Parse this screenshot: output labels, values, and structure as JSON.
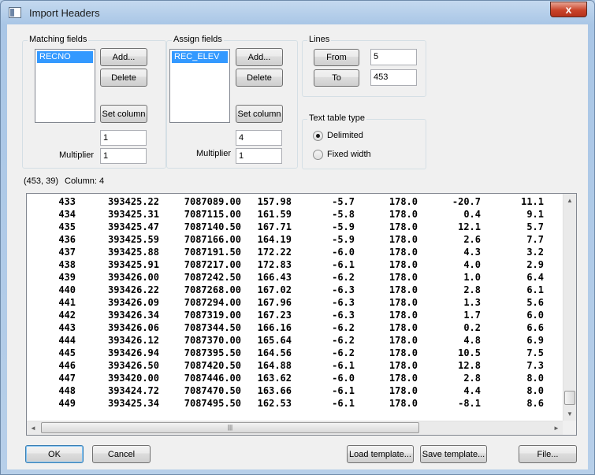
{
  "window": {
    "title": "Import Headers",
    "close_label": "x"
  },
  "matching": {
    "legend": "Matching fields",
    "selected_item": "RECNO",
    "add_label": "Add...",
    "delete_label": "Delete",
    "set_column_label": "Set column",
    "column_value": "1",
    "multiplier_label": "Multiplier",
    "multiplier_value": "1"
  },
  "assign": {
    "legend": "Assign fields",
    "selected_item": "REC_ELEV",
    "add_label": "Add...",
    "delete_label": "Delete",
    "set_column_label": "Set column",
    "column_value": "4",
    "multiplier_label": "Multiplier",
    "multiplier_value": "1"
  },
  "lines": {
    "legend": "Lines",
    "from_label": "From",
    "from_value": "5",
    "to_label": "To",
    "to_value": "453"
  },
  "text_table": {
    "legend": "Text table type",
    "delimited_label": "Delimited",
    "delimited_checked": true,
    "fixed_label": "Fixed width",
    "fixed_checked": false
  },
  "status": {
    "position": "(453, 39)",
    "column": "Column: 4"
  },
  "data_rows": [
    [
      "433",
      "393425.22",
      "7087089.00",
      "157.98",
      "-5.7",
      "178.0",
      "-20.7",
      "11.1"
    ],
    [
      "434",
      "393425.31",
      "7087115.00",
      "161.59",
      "-5.8",
      "178.0",
      "0.4",
      "9.1"
    ],
    [
      "435",
      "393425.47",
      "7087140.50",
      "167.71",
      "-5.9",
      "178.0",
      "12.1",
      "5.7"
    ],
    [
      "436",
      "393425.59",
      "7087166.00",
      "164.19",
      "-5.9",
      "178.0",
      "2.6",
      "7.7"
    ],
    [
      "437",
      "393425.88",
      "7087191.50",
      "172.22",
      "-6.0",
      "178.0",
      "4.3",
      "3.2"
    ],
    [
      "438",
      "393425.91",
      "7087217.00",
      "172.83",
      "-6.1",
      "178.0",
      "4.0",
      "2.9"
    ],
    [
      "439",
      "393426.00",
      "7087242.50",
      "166.43",
      "-6.2",
      "178.0",
      "1.0",
      "6.4"
    ],
    [
      "440",
      "393426.22",
      "7087268.00",
      "167.02",
      "-6.3",
      "178.0",
      "2.8",
      "6.1"
    ],
    [
      "441",
      "393426.09",
      "7087294.00",
      "167.96",
      "-6.3",
      "178.0",
      "1.3",
      "5.6"
    ],
    [
      "442",
      "393426.34",
      "7087319.00",
      "167.23",
      "-6.3",
      "178.0",
      "1.7",
      "6.0"
    ],
    [
      "443",
      "393426.06",
      "7087344.50",
      "166.16",
      "-6.2",
      "178.0",
      "0.2",
      "6.6"
    ],
    [
      "444",
      "393426.12",
      "7087370.00",
      "165.64",
      "-6.2",
      "178.0",
      "4.8",
      "6.9"
    ],
    [
      "445",
      "393426.94",
      "7087395.50",
      "164.56",
      "-6.2",
      "178.0",
      "10.5",
      "7.5"
    ],
    [
      "446",
      "393426.50",
      "7087420.50",
      "164.88",
      "-6.1",
      "178.0",
      "12.8",
      "7.3"
    ],
    [
      "447",
      "393420.00",
      "7087446.00",
      "163.62",
      "-6.0",
      "178.0",
      "2.8",
      "8.0"
    ],
    [
      "448",
      "393424.72",
      "7087470.50",
      "163.66",
      "-6.1",
      "178.0",
      "4.4",
      "8.0"
    ],
    [
      "449",
      "393425.34",
      "7087495.50",
      "162.53",
      "-6.1",
      "178.0",
      "-8.1",
      "8.6"
    ]
  ],
  "scroll": {
    "up": "▲",
    "down": "▼",
    "left": "◄",
    "right": "►",
    "grip": "|||"
  },
  "footer": {
    "ok_label": "OK",
    "cancel_label": "Cancel",
    "load_template_label": "Load template...",
    "save_template_label": "Save template...",
    "file_label": "File..."
  }
}
